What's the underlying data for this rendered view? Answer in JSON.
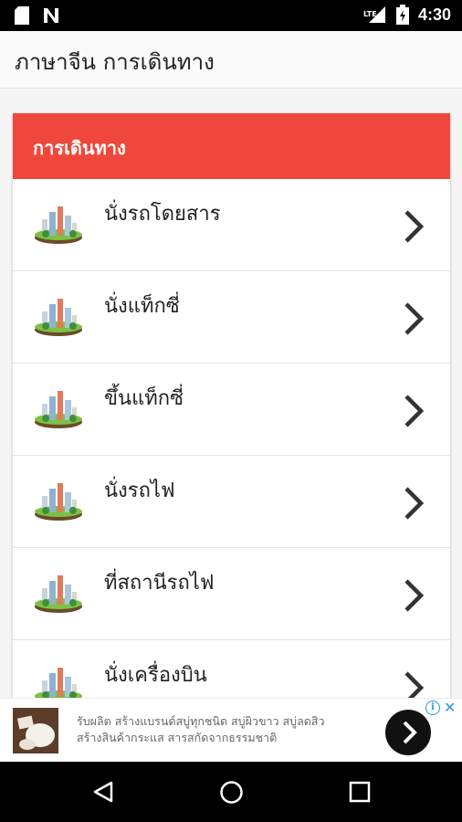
{
  "status_bar": {
    "time": "4:30",
    "network_label": "LTE",
    "icons": [
      "sd-card-icon",
      "n-notification-icon",
      "lte-signal-icon",
      "battery-charging-icon"
    ]
  },
  "app_bar": {
    "title": "ภาษาจีน การเดินทาง"
  },
  "card": {
    "header_title": "การเดินทาง",
    "header_color": "#f0473c",
    "items": [
      {
        "label": "นั่งรถโดยสาร",
        "icon": "city-illustration-icon"
      },
      {
        "label": "นั่งแท็กซี่",
        "icon": "city-illustration-icon"
      },
      {
        "label": "ขึ้นแท็กซี่",
        "icon": "city-illustration-icon"
      },
      {
        "label": "นั่งรถไฟ",
        "icon": "city-illustration-icon"
      },
      {
        "label": "ที่สถานีรถไฟ",
        "icon": "city-illustration-icon"
      },
      {
        "label": "นั่งเครื่องบิน",
        "icon": "city-illustration-icon"
      }
    ]
  },
  "ad": {
    "line1": "รับผลิต สร้างแบรนด์สบู่ทุกชนิด สบู่ผิวขาว สบู่ลดสิว",
    "line2": "สร้างสินค้ากระแส สารสกัดจากธรรมชาติ",
    "info_label": "i",
    "close_label": "✕",
    "accent_color": "#2b95d6"
  },
  "nav_bar": {
    "icons": [
      "back-icon",
      "home-icon",
      "recents-icon"
    ]
  }
}
